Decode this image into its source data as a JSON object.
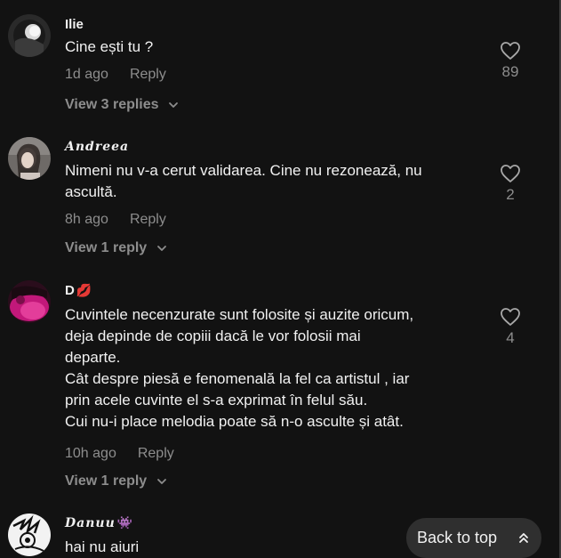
{
  "comments": [
    {
      "username": "Ilie",
      "text": "Cine ești tu ?",
      "time": "1d ago",
      "reply_label": "Reply",
      "view_replies": "View 3 replies",
      "likes": "89",
      "avatar_icon": "avatar-dark-photo"
    },
    {
      "username": "𝑨𝒏𝒅𝒓𝒆𝒆𝒂",
      "text": "Nimeni nu v-a cerut validarea. Cine nu rezonează, nu\nascultă.",
      "time": "8h ago",
      "reply_label": "Reply",
      "view_replies": "View 1 reply",
      "likes": "2",
      "avatar_icon": "avatar-person-photo"
    },
    {
      "username": "D",
      "username_emoji": "💋",
      "text": "Cuvintele necenzurate sunt folosite și auzite oricum,\ndeja depinde de copiii dacă le vor folosii mai\ndeparte.\nCât despre piesă e fenomenală la fel ca artistul , iar\nprin acele cuvinte el s-a exprimat în felul său.\nCui nu-i place melodia poate să n-o asculte și atât.",
      "time": "10h ago",
      "reply_label": "Reply",
      "view_replies": "View 1 reply",
      "likes": "4",
      "avatar_icon": "avatar-pink-photo"
    },
    {
      "username": "𝑫𝒂𝒏𝒖𝒖",
      "username_emoji": "👾",
      "text": "hai nu aiuri",
      "avatar_icon": "avatar-sketch-photo"
    }
  ],
  "back_to_top": {
    "label": "Back to top",
    "icon": "double-chevron-up-icon"
  },
  "colors": {
    "background": "#121212",
    "primary_text": "#f1f1f1",
    "secondary_text": "#8d8d8d",
    "button_bg": "#2f2f2f"
  }
}
